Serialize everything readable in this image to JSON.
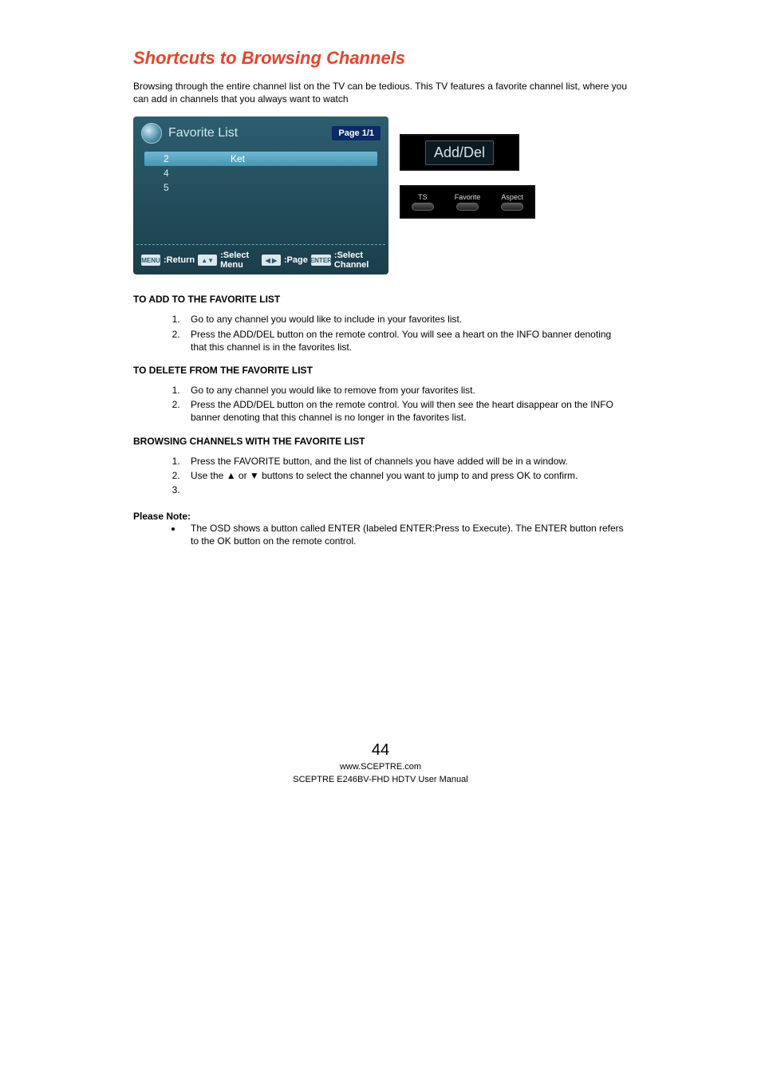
{
  "heading": "Shortcuts to Browsing Channels",
  "intro": "Browsing through the entire channel list on the TV can be tedious.  This TV features a favorite channel list, where you can add in channels that you always want to watch",
  "osd": {
    "title": "Favorite List",
    "page_badge": "Page 1/1",
    "rows": {
      "r0_ch": "2",
      "r0_lbl": "Ket",
      "r1_ch": "4",
      "r2_ch": "5"
    },
    "footer": {
      "k1": "MENU",
      "t1": ":Return",
      "k2": "▲▼",
      "t2": ":Select Menu",
      "k3": "◀ ▶",
      "t3": ":Page",
      "k4": "ENTER",
      "t4": ":Select Channel"
    }
  },
  "adddel_label": "Add/Del",
  "remote": {
    "b1": "TS",
    "b2": "Favorite",
    "b3": "Aspect"
  },
  "sections": {
    "add_title": "TO ADD TO THE FAVORITE LIST",
    "add": {
      "s1": "Go to any channel you would like to include in your favorites list.",
      "s2": "Press the ADD/DEL button on the remote control.  You will see a heart on the INFO banner denoting that this channel is in the favorites list."
    },
    "del_title": "TO DELETE FROM THE FAVORITE LIST",
    "del": {
      "s1": "Go to any channel you would like to remove from your favorites list.",
      "s2": "Press the ADD/DEL button on the remote control.  You will then see the heart disappear on the INFO banner denoting that this channel is no longer in the favorites list."
    },
    "browse_title": "BROWSING CHANNELS WITH THE FAVORITE LIST",
    "browse": {
      "s1": "Press the FAVORITE button, and the list of channels you have added will be in a window.",
      "s2": "Use the ▲ or ▼ buttons to select the channel you want to jump to and press OK to confirm.",
      "s3": ""
    }
  },
  "note_title": "Please Note:",
  "note1": "The OSD shows a button called ENTER (labeled ENTER:Press to Execute).  The ENTER button refers to the OK button on the remote control.",
  "footer": {
    "page_number": "44",
    "url": "www.SCEPTRE.com",
    "manual": "SCEPTRE E246BV-FHD HDTV User Manual"
  }
}
